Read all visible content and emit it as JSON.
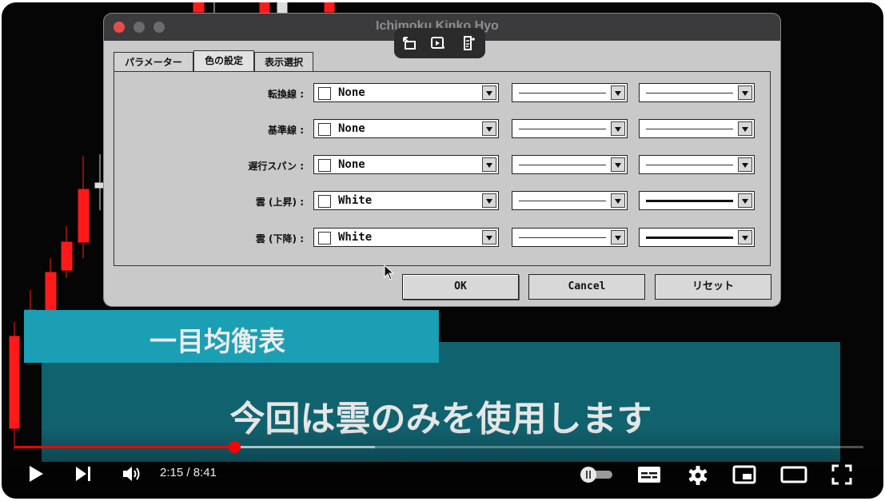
{
  "window": {
    "title": "Ichimoku Kinko Hyo"
  },
  "tabs": [
    {
      "label": "パラメーター",
      "active": false
    },
    {
      "label": "色の設定",
      "active": true
    },
    {
      "label": "表示選択",
      "active": false
    }
  ],
  "rows": [
    {
      "label": "転換線 :",
      "color": "None",
      "line_style": "thin",
      "width_style": "thin"
    },
    {
      "label": "基準線 :",
      "color": "None",
      "line_style": "thin",
      "width_style": "thin"
    },
    {
      "label": "遅行スパン :",
      "color": "None",
      "line_style": "thin",
      "width_style": "thin"
    },
    {
      "label": "雲 (上昇) :",
      "color": "White",
      "line_style": "thin",
      "width_style": "thick"
    },
    {
      "label": "雲 (下降) :",
      "color": "White",
      "line_style": "thin",
      "width_style": "thick"
    }
  ],
  "buttons": {
    "ok": "OK",
    "cancel": "Cancel",
    "reset": "リセット"
  },
  "captions": {
    "title": "一目均衡表",
    "main": "今回は雲のみを使用します"
  },
  "player": {
    "time": "2:15 / 8:41",
    "progress": 0.26,
    "buffered": 0.425
  },
  "icons": [
    "play-icon",
    "next-icon",
    "volume-icon",
    "autoplay-toggle-icon",
    "subtitles-icon",
    "settings-icon",
    "miniplayer-icon",
    "theater-icon",
    "fullscreen-icon",
    "queue-icon",
    "clip-icon",
    "notes-icon"
  ],
  "colors": {
    "accent": "#ff0000",
    "caption_title_bg": "#1a9fb4",
    "caption_main_bg": "#147382"
  }
}
